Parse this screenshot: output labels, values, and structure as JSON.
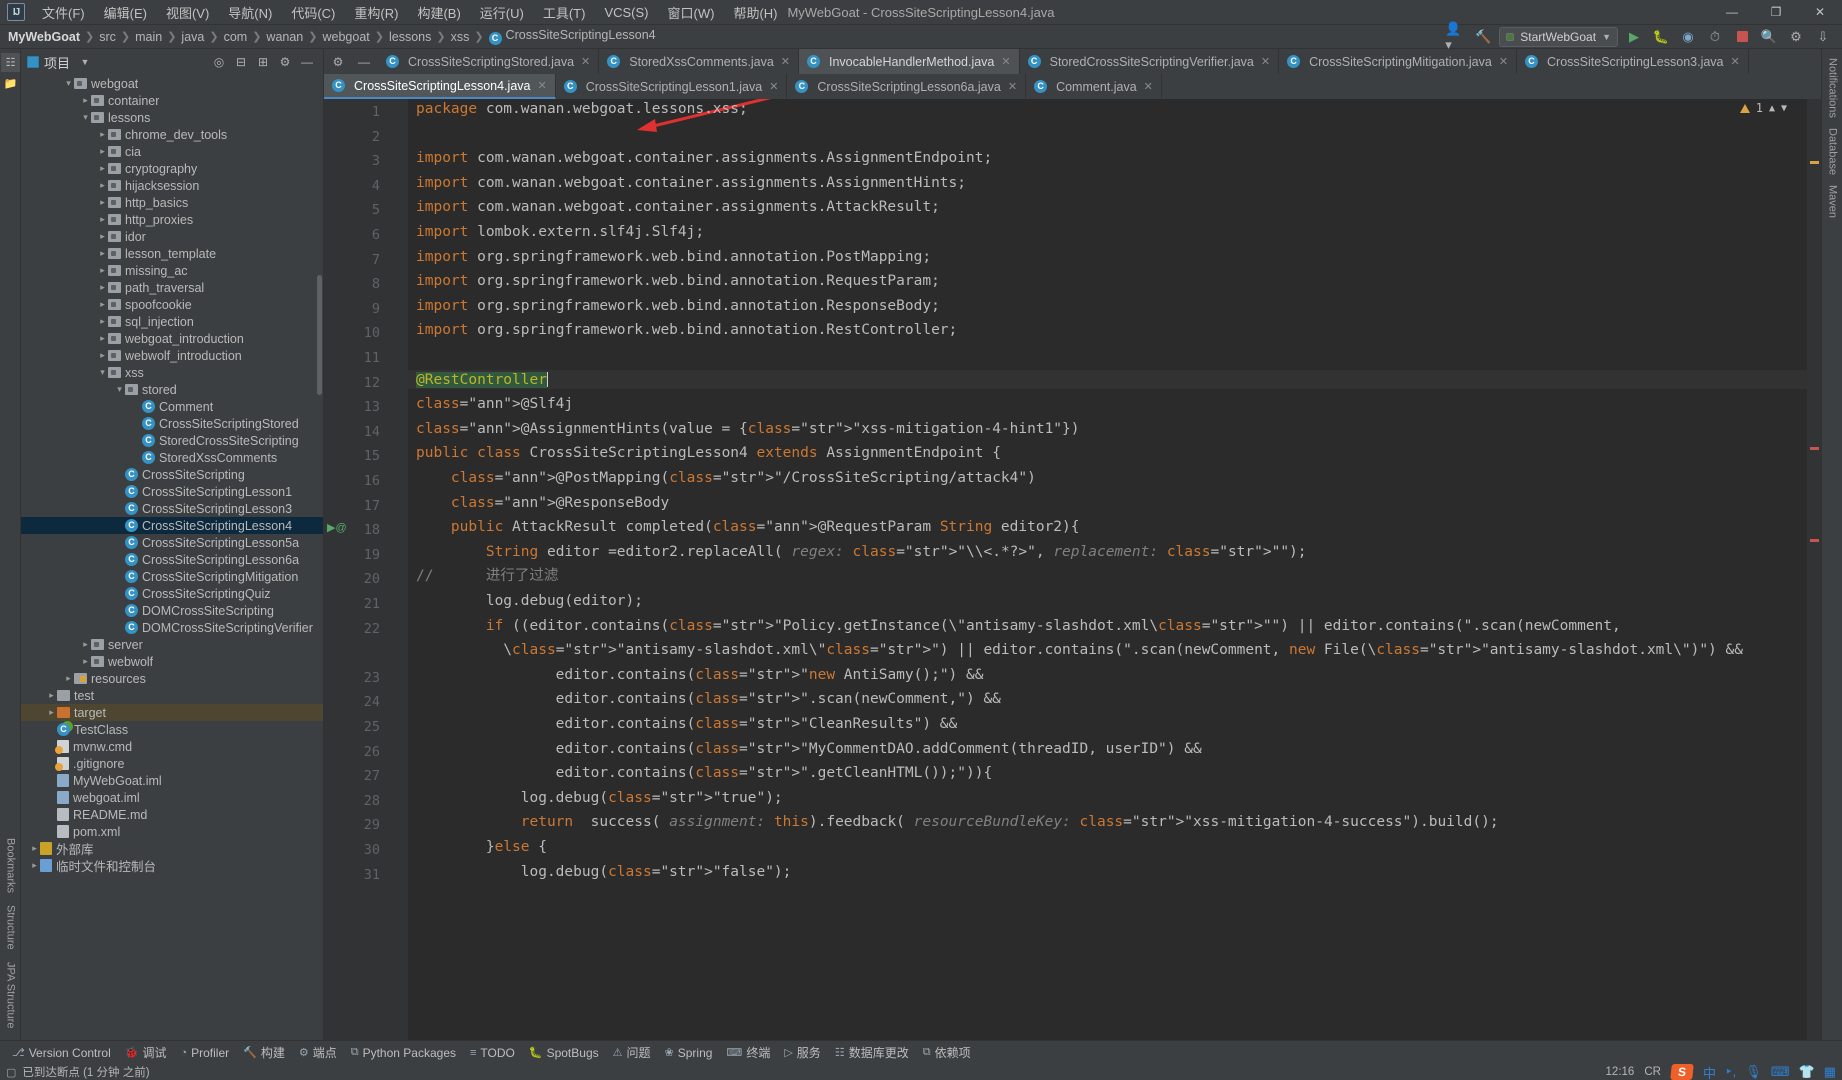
{
  "window": {
    "title": "MyWebGoat - CrossSiteScriptingLesson4.java",
    "logo": "IJ",
    "minimize": "—",
    "maximize": "❐",
    "close": "✕"
  },
  "menubar": [
    {
      "label": "文件(F)"
    },
    {
      "label": "编辑(E)"
    },
    {
      "label": "视图(V)"
    },
    {
      "label": "导航(N)"
    },
    {
      "label": "代码(C)"
    },
    {
      "label": "重构(R)"
    },
    {
      "label": "构建(B)"
    },
    {
      "label": "运行(U)"
    },
    {
      "label": "工具(T)"
    },
    {
      "label": "VCS(S)"
    },
    {
      "label": "窗口(W)"
    },
    {
      "label": "帮助(H)"
    }
  ],
  "breadcrumbs": [
    {
      "label": "MyWebGoat",
      "bold": true
    },
    {
      "label": "src"
    },
    {
      "label": "main"
    },
    {
      "label": "java"
    },
    {
      "label": "com"
    },
    {
      "label": "wanan"
    },
    {
      "label": "webgoat"
    },
    {
      "label": "lessons"
    },
    {
      "label": "xss"
    },
    {
      "label": "CrossSiteScriptingLesson4",
      "icon": "class-icon"
    }
  ],
  "toolbar": {
    "run_config": "StartWebGoat",
    "account_icon": "account-icon",
    "hammer_icon": "build-icon",
    "run_icon": "run-icon",
    "debug_icon": "debug-icon",
    "coverage_icon": "coverage-icon",
    "profile_icon": "profile-icon",
    "stop_icon": "stop-icon",
    "search_icon": "search-icon",
    "settings_icon": "settings-icon",
    "updates_icon": "updates-icon"
  },
  "project_panel": {
    "title": "项目",
    "dropdown_icon": "chevron-down-icon",
    "actions": [
      "locate-icon",
      "collapse-all-icon",
      "expand-all-icon",
      "settings-icon",
      "hide-icon"
    ],
    "tree": [
      {
        "label": "webgoat",
        "depth": 2,
        "arrow": "v",
        "kind": "folder"
      },
      {
        "label": "container",
        "depth": 3,
        "arrow": ">",
        "kind": "folder"
      },
      {
        "label": "lessons",
        "depth": 3,
        "arrow": "v",
        "kind": "folder"
      },
      {
        "label": "chrome_dev_tools",
        "depth": 4,
        "arrow": ">",
        "kind": "folder"
      },
      {
        "label": "cia",
        "depth": 4,
        "arrow": ">",
        "kind": "folder"
      },
      {
        "label": "cryptography",
        "depth": 4,
        "arrow": ">",
        "kind": "folder"
      },
      {
        "label": "hijacksession",
        "depth": 4,
        "arrow": ">",
        "kind": "folder"
      },
      {
        "label": "http_basics",
        "depth": 4,
        "arrow": ">",
        "kind": "folder"
      },
      {
        "label": "http_proxies",
        "depth": 4,
        "arrow": ">",
        "kind": "folder"
      },
      {
        "label": "idor",
        "depth": 4,
        "arrow": ">",
        "kind": "folder"
      },
      {
        "label": "lesson_template",
        "depth": 4,
        "arrow": ">",
        "kind": "folder"
      },
      {
        "label": "missing_ac",
        "depth": 4,
        "arrow": ">",
        "kind": "folder"
      },
      {
        "label": "path_traversal",
        "depth": 4,
        "arrow": ">",
        "kind": "folder"
      },
      {
        "label": "spoofcookie",
        "depth": 4,
        "arrow": ">",
        "kind": "folder"
      },
      {
        "label": "sql_injection",
        "depth": 4,
        "arrow": ">",
        "kind": "folder"
      },
      {
        "label": "webgoat_introduction",
        "depth": 4,
        "arrow": ">",
        "kind": "folder"
      },
      {
        "label": "webwolf_introduction",
        "depth": 4,
        "arrow": ">",
        "kind": "folder"
      },
      {
        "label": "xss",
        "depth": 4,
        "arrow": "v",
        "kind": "folder"
      },
      {
        "label": "stored",
        "depth": 5,
        "arrow": "v",
        "kind": "folder"
      },
      {
        "label": "Comment",
        "depth": 6,
        "arrow": "",
        "kind": "class"
      },
      {
        "label": "CrossSiteScriptingStored",
        "depth": 6,
        "arrow": "",
        "kind": "class"
      },
      {
        "label": "StoredCrossSiteScripting",
        "depth": 6,
        "arrow": "",
        "kind": "class"
      },
      {
        "label": "StoredXssComments",
        "depth": 6,
        "arrow": "",
        "kind": "class"
      },
      {
        "label": "CrossSiteScripting",
        "depth": 5,
        "arrow": "",
        "kind": "class"
      },
      {
        "label": "CrossSiteScriptingLesson1",
        "depth": 5,
        "arrow": "",
        "kind": "class"
      },
      {
        "label": "CrossSiteScriptingLesson3",
        "depth": 5,
        "arrow": "",
        "kind": "class"
      },
      {
        "label": "CrossSiteScriptingLesson4",
        "depth": 5,
        "arrow": "",
        "kind": "class",
        "selected": true
      },
      {
        "label": "CrossSiteScriptingLesson5a",
        "depth": 5,
        "arrow": "",
        "kind": "class"
      },
      {
        "label": "CrossSiteScriptingLesson6a",
        "depth": 5,
        "arrow": "",
        "kind": "class"
      },
      {
        "label": "CrossSiteScriptingMitigation",
        "depth": 5,
        "arrow": "",
        "kind": "class"
      },
      {
        "label": "CrossSiteScriptingQuiz",
        "depth": 5,
        "arrow": "",
        "kind": "class"
      },
      {
        "label": "DOMCrossSiteScripting",
        "depth": 5,
        "arrow": "",
        "kind": "class"
      },
      {
        "label": "DOMCrossSiteScriptingVerifier",
        "depth": 5,
        "arrow": "",
        "kind": "class"
      },
      {
        "label": "server",
        "depth": 3,
        "arrow": ">",
        "kind": "folder"
      },
      {
        "label": "webwolf",
        "depth": 3,
        "arrow": ">",
        "kind": "folder"
      },
      {
        "label": "resources",
        "depth": 2,
        "arrow": ">",
        "kind": "resources"
      },
      {
        "label": "test",
        "depth": 1,
        "arrow": ">",
        "kind": "folder-plain"
      },
      {
        "label": "target",
        "depth": 1,
        "arrow": ">",
        "kind": "folder-orange",
        "target": true
      },
      {
        "label": "TestClass",
        "depth": 1,
        "arrow": "",
        "kind": "class-green"
      },
      {
        "label": "mvnw.cmd",
        "depth": 1,
        "arrow": "",
        "kind": "file-gear"
      },
      {
        "label": ".gitignore",
        "depth": 1,
        "arrow": "",
        "kind": "file-gear"
      },
      {
        "label": "MyWebGoat.iml",
        "depth": 1,
        "arrow": "",
        "kind": "file-blue"
      },
      {
        "label": "webgoat.iml",
        "depth": 1,
        "arrow": "",
        "kind": "file-blue"
      },
      {
        "label": "README.md",
        "depth": 1,
        "arrow": "",
        "kind": "file-md"
      },
      {
        "label": "pom.xml",
        "depth": 1,
        "arrow": "",
        "kind": "file-xml"
      },
      {
        "label": "外部库",
        "depth": 0,
        "arrow": ">",
        "kind": "library"
      },
      {
        "label": "临时文件和控制台",
        "depth": 0,
        "arrow": ">",
        "kind": "scratch"
      }
    ]
  },
  "editor_tabs_row1": [
    {
      "label": "CrossSiteScriptingStored.java",
      "state": "normal"
    },
    {
      "label": "StoredXssComments.java",
      "state": "normal"
    },
    {
      "label": "InvocableHandlerMethod.java",
      "state": "active"
    },
    {
      "label": "StoredCrossSiteScriptingVerifier.java",
      "state": "normal"
    },
    {
      "label": "CrossSiteScriptingMitigation.java",
      "state": "normal"
    },
    {
      "label": "CrossSiteScriptingLesson3.java",
      "state": "normal"
    }
  ],
  "editor_tabs_row2": [
    {
      "label": "CrossSiteScriptingLesson4.java",
      "state": "selected"
    },
    {
      "label": "CrossSiteScriptingLesson1.java",
      "state": "normal"
    },
    {
      "label": "CrossSiteScriptingLesson6a.java",
      "state": "normal"
    },
    {
      "label": "Comment.java",
      "state": "normal"
    }
  ],
  "editor": {
    "warning_count": "1",
    "warning_icon": "warning-triangle-icon",
    "up_icon": "chevron-up-icon",
    "down_icon": "chevron-down-icon",
    "current_line": 12,
    "lines": [
      {
        "n": 1,
        "text": "package com.wanan.webgoat.lessons.xss;"
      },
      {
        "n": 2,
        "text": ""
      },
      {
        "n": 3,
        "text": "import com.wanan.webgoat.container.assignments.AssignmentEndpoint;"
      },
      {
        "n": 4,
        "text": "import com.wanan.webgoat.container.assignments.AssignmentHints;"
      },
      {
        "n": 5,
        "text": "import com.wanan.webgoat.container.assignments.AttackResult;"
      },
      {
        "n": 6,
        "text": "import lombok.extern.slf4j.Slf4j;"
      },
      {
        "n": 7,
        "text": "import org.springframework.web.bind.annotation.PostMapping;"
      },
      {
        "n": 8,
        "text": "import org.springframework.web.bind.annotation.RequestParam;"
      },
      {
        "n": 9,
        "text": "import org.springframework.web.bind.annotation.ResponseBody;"
      },
      {
        "n": 10,
        "text": "import org.springframework.web.bind.annotation.RestController;"
      },
      {
        "n": 11,
        "text": ""
      },
      {
        "n": 12,
        "text": "@RestController"
      },
      {
        "n": 13,
        "text": "@Slf4j"
      },
      {
        "n": 14,
        "text": "@AssignmentHints(value = {\"xss-mitigation-4-hint1\"})"
      },
      {
        "n": 15,
        "text": "public class CrossSiteScriptingLesson4 extends AssignmentEndpoint {"
      },
      {
        "n": 16,
        "text": "    @PostMapping(\"/CrossSiteScripting/attack4\")"
      },
      {
        "n": 17,
        "text": "    @ResponseBody"
      },
      {
        "n": 18,
        "text": "    public AttackResult completed(@RequestParam String editor2){"
      },
      {
        "n": 19,
        "text": "        String editor =editor2.replaceAll( regex: \"\\\\<.*?>\", replacement: \"\");"
      },
      {
        "n": 20,
        "text": "//      进行了过滤"
      },
      {
        "n": 21,
        "text": "        log.debug(editor);"
      },
      {
        "n": 22,
        "text": "        if ((editor.contains(\"Policy.getInstance(\\\"antisamy-slashdot.xml\\\"\") || editor.contains(\".scan(newComment,"
      },
      {
        "n": 22.5,
        "text": "          \\\"antisamy-slashdot.xml\\\"\") || editor.contains(\".scan(newComment, new File(\\\"antisamy-slashdot.xml\\\")\") &&"
      },
      {
        "n": 23,
        "text": "                editor.contains(\"new AntiSamy();\") &&"
      },
      {
        "n": 24,
        "text": "                editor.contains(\".scan(newComment,\") &&"
      },
      {
        "n": 25,
        "text": "                editor.contains(\"CleanResults\") &&"
      },
      {
        "n": 26,
        "text": "                editor.contains(\"MyCommentDAO.addComment(threadID, userID\") &&"
      },
      {
        "n": 27,
        "text": "                editor.contains(\".getCleanHTML());\")){"
      },
      {
        "n": 28,
        "text": "            log.debug(\"true\");"
      },
      {
        "n": 29,
        "text": "            return  success( assignment: this).feedback( resourceBundleKey: \"xss-mitigation-4-success\").build();"
      },
      {
        "n": 30,
        "text": "        }else {"
      },
      {
        "n": 31,
        "text": "            log.debug(\"false\");"
      }
    ]
  },
  "right_rail": [
    {
      "label": "Notifications",
      "name": "notifications"
    },
    {
      "label": "Database",
      "name": "database"
    },
    {
      "label": "Maven",
      "name": "maven"
    }
  ],
  "left_rail": [
    {
      "label": "Bookmarks",
      "name": "bookmarks"
    },
    {
      "label": "Structure",
      "name": "structure"
    },
    {
      "label": "JPA Structure",
      "name": "jpa-structure"
    }
  ],
  "bottom_toolbar": [
    {
      "label": "Version Control",
      "icon": "branch-icon"
    },
    {
      "label": "调试",
      "icon": "debug-icon"
    },
    {
      "label": "Profiler",
      "icon": "profiler-icon"
    },
    {
      "label": "构建",
      "icon": "build-icon"
    },
    {
      "label": "端点",
      "icon": "endpoints-icon"
    },
    {
      "label": "Python Packages",
      "icon": "python-icon"
    },
    {
      "label": "TODO",
      "icon": "todo-icon"
    },
    {
      "label": "SpotBugs",
      "icon": "spotbugs-icon"
    },
    {
      "label": "问题",
      "icon": "problems-icon"
    },
    {
      "label": "Spring",
      "icon": "spring-icon"
    },
    {
      "label": "终端",
      "icon": "terminal-icon"
    },
    {
      "label": "服务",
      "icon": "services-icon"
    },
    {
      "label": "数据库更改",
      "icon": "db-changes-icon"
    },
    {
      "label": "依赖项",
      "icon": "dependencies-icon"
    }
  ],
  "statusbar": {
    "message": "已到达断点 (1 分钟 之前)",
    "message_icon": "breakpoint-icon",
    "time": "12:16",
    "locale": "CR",
    "ime": "中",
    "tray_icons": [
      "sogou-icon",
      "ime-chinese-icon",
      "punctuation-icon",
      "mic-icon",
      "keyboard-icon",
      "skin-icon",
      "apps-icon"
    ]
  },
  "colors": {
    "bg_panel": "#3c3f41",
    "bg_editor": "#2b2b2b",
    "accent_blue": "#3592c4",
    "selection": "#0d293e",
    "keyword": "#cc7832",
    "annotation": "#bbb529",
    "string": "#6a8759",
    "arrow_red": "#e03030"
  }
}
